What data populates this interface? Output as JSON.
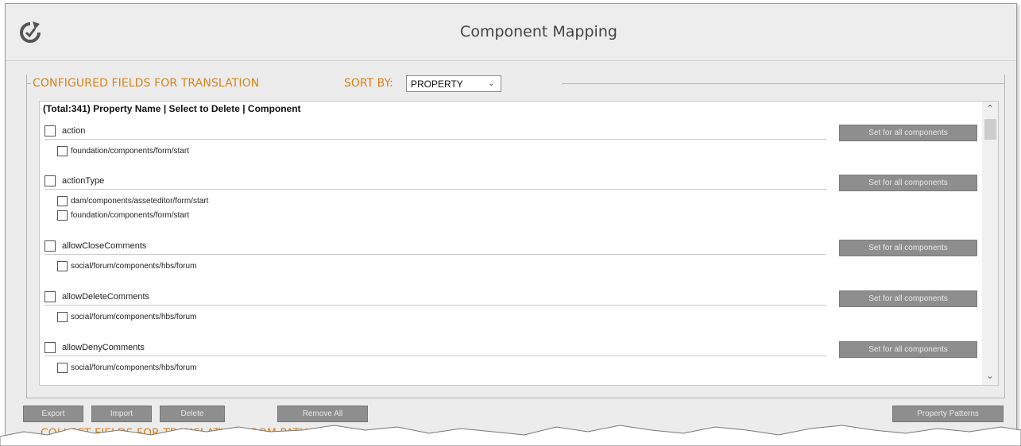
{
  "header": {
    "title": "Component Mapping",
    "logo_icon": "refresh-check-logo-icon"
  },
  "configured": {
    "legend": "CONFIGURED FIELDS FOR TRANSLATION",
    "sort_label": "SORT BY:",
    "sort_value": "PROPERTY",
    "list_header": "(Total:341) Property Name | Select to Delete | Component",
    "set_all_label": "Set for all components",
    "properties": [
      {
        "name": "action",
        "components": [
          "foundation/components/form/start"
        ]
      },
      {
        "name": "actionType",
        "components": [
          "dam/components/asseteditor/form/start",
          "foundation/components/form/start"
        ]
      },
      {
        "name": "allowCloseComments",
        "components": [
          "social/forum/components/hbs/forum"
        ]
      },
      {
        "name": "allowDeleteComments",
        "components": [
          "social/forum/components/hbs/forum"
        ]
      },
      {
        "name": "allowDenyComments",
        "components": [
          "social/forum/components/hbs/forum"
        ]
      }
    ]
  },
  "buttons": {
    "export": "Export",
    "import": "Import",
    "delete": "Delete",
    "remove_all": "Remove All",
    "property_patterns": "Property Patterns"
  },
  "collect": {
    "legend": "COLLECT FIELDS FOR TRANSLATION FROM PATH"
  },
  "colors": {
    "accent_orange": "#d8831a",
    "button_gray": "#8e8e8e",
    "background": "#ececec"
  }
}
